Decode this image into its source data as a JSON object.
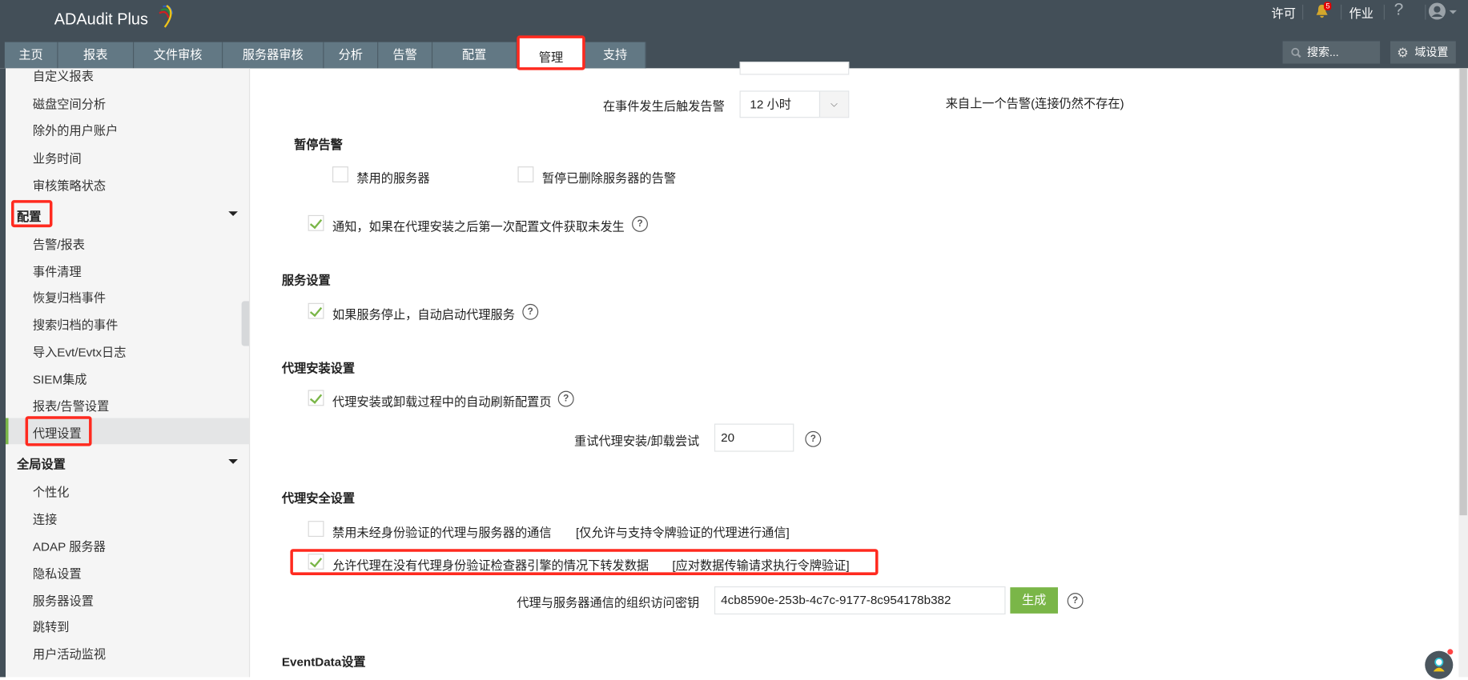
{
  "app": {
    "title": "ADAudit Plus"
  },
  "tabs": [
    "主页",
    "报表",
    "文件审核",
    "服务器审核",
    "分析",
    "告警",
    "配置",
    "管理",
    "支持"
  ],
  "active_tab": "管理",
  "topbar": {
    "license": "许可",
    "notification_count": "5",
    "jobs": "作业",
    "help": "?",
    "search_placeholder": "搜索...",
    "domain_settings": "域设置"
  },
  "sidebar": {
    "top_items": [
      "自定义报表",
      "磁盘空间分析",
      "除外的用户账户",
      "业务时间",
      "审核策略状态"
    ],
    "config_header": "配置",
    "config_items": [
      "告警/报表",
      "事件清理",
      "恢复归档事件",
      "搜索归档的事件",
      "导入Evt/Evtx日志",
      "SIEM集成",
      "报表/告警设置",
      "代理设置"
    ],
    "selected": "代理设置",
    "global_header": "全局设置",
    "global_items": [
      "个性化",
      "连接",
      "ADAP 服务器",
      "隐私设置",
      "服务器设置",
      "跳转到",
      "用户活动监视"
    ]
  },
  "content": {
    "trigger_label": "在事件发生后触发告警",
    "trigger_value": "12 小时",
    "trigger_note": "来自上一个告警(连接仍然不存在)",
    "pause_header": "暂停告警",
    "pause_disabled": {
      "label": "禁用的服务器",
      "checked": false
    },
    "pause_deleted": {
      "label": "暂停已删除服务器的告警",
      "checked": false
    },
    "notify": {
      "label": "通知，如果在代理安装之后第一次配置文件获取未发生",
      "checked": true
    },
    "service_header": "服务设置",
    "auto_start": {
      "label": "如果服务停止，自动启动代理服务",
      "checked": true
    },
    "install_header": "代理安装设置",
    "auto_refresh": {
      "label": "代理安装或卸载过程中的自动刷新配置页",
      "checked": true
    },
    "retry_label": "重试代理安装/卸载尝试",
    "retry_value": "20",
    "security_header": "代理安全设置",
    "disable_unauth": {
      "label": "禁用未经身份验证的代理与服务器的通信",
      "note": "[仅允许与支持令牌验证的代理进行通信]",
      "checked": false
    },
    "allow_forward": {
      "label": "允许代理在没有代理身份验证检查器引擎的情况下转发数据",
      "note": "[应对数据传输请求执行令牌验证]",
      "checked": true
    },
    "key_label": "代理与服务器通信的组织访问密钥",
    "key_value": "4cb8590e-253b-4c7c-9177-8c954178b382",
    "generate": "生成",
    "eventdata_header": "EventData设置"
  },
  "colors": {
    "header": "#434f58",
    "tab": "#627884",
    "accent": "#7ab648",
    "highlight": "#ff2a1f"
  }
}
